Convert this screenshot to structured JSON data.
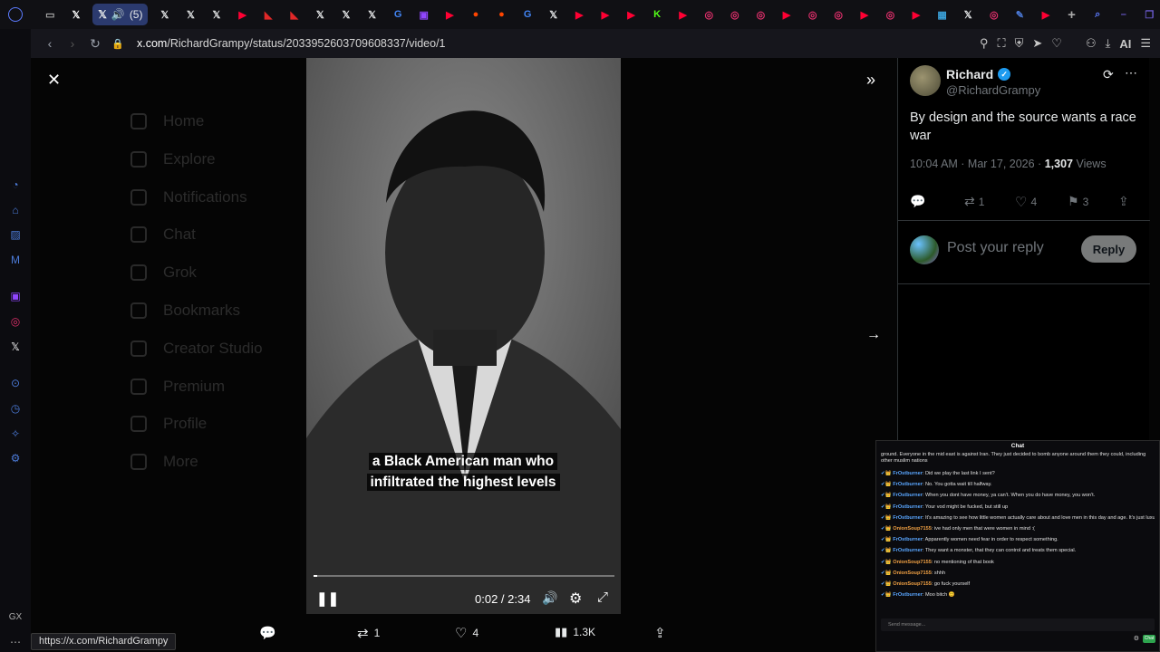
{
  "browser": {
    "tab_count_badge": "(5)",
    "url_host": "x.com",
    "url_path": "/RichardGrampy/status/2033952603709608337/video/1",
    "ai_label": "AI",
    "status_url": "https://x.com/RichardGrampy"
  },
  "background_nav": [
    "Home",
    "Explore",
    "Notifications",
    "Chat",
    "Grok",
    "Bookmarks",
    "Creator Studio",
    "Premium",
    "Profile",
    "More"
  ],
  "video": {
    "subtitle_line1": "a Black American man who",
    "subtitle_line2": "infiltrated the highest levels",
    "time": "0:02 / 2:34",
    "progress_fraction": 0.013
  },
  "video_actions": {
    "reposts": "1",
    "likes": "4",
    "views": "1.3K"
  },
  "tweet": {
    "name": "Richard",
    "handle": "@RichardGrampy",
    "text": "By design and the source wants a race war",
    "time": "10:04 AM · Mar 17, 2026 · ",
    "views_count": "1,307",
    "views_label": " Views",
    "reposts": "1",
    "likes": "4",
    "bookmarks": "3",
    "reply_placeholder": "Post your reply",
    "reply_button": "Reply"
  },
  "chat": {
    "title": "Chat",
    "top_text": "ground. Everyone in the mid east is against Iran. They just decided to bomb anyone around them they could, including other muslim nations",
    "messages": [
      {
        "user": "FrOstburner",
        "text": ": Did we play the last link I sent?",
        "color": "blue"
      },
      {
        "user": "FrOstburner",
        "text": ": No. You gotta wait till halfway.",
        "color": "blue"
      },
      {
        "user": "FrOstburner",
        "text": ": When you dont have money, ya can't. When you do have money, you won't.",
        "color": "blue"
      },
      {
        "user": "FrOstburner",
        "text": ": Your vod might be fucked, but still up",
        "color": "blue"
      },
      {
        "user": "FrOstburner",
        "text": ": It's amazing to see how little women actually care about and love men in this day and age. It's just luxury and security with sex on the side.",
        "color": "blue"
      },
      {
        "user": "OnionSoup7155",
        "text": ": ive had only men that were women in mind :(",
        "color": "orange"
      },
      {
        "user": "FrOstburner",
        "text": ": Apparently women need fear in order to respect something.",
        "color": "blue"
      },
      {
        "user": "FrOstburner",
        "text": ": They want a monster, that they can control and treats them special.",
        "color": "blue"
      },
      {
        "user": "OnionSoup7155",
        "text": ": no mentioning of that book",
        "color": "orange"
      },
      {
        "user": "OnionSoup7155",
        "text": ": shhh",
        "color": "orange"
      },
      {
        "user": "OnionSoup7155",
        "text": ": go fuck yourself",
        "color": "orange"
      },
      {
        "user": "FrOstburner",
        "text": ": Moo bitch 😊",
        "color": "blue"
      }
    ],
    "input_placeholder": "Send message...",
    "send_label": "Chat"
  },
  "colors": {
    "accent_blue": "#1d9bf0",
    "tab_active": "#2b3a6e"
  }
}
